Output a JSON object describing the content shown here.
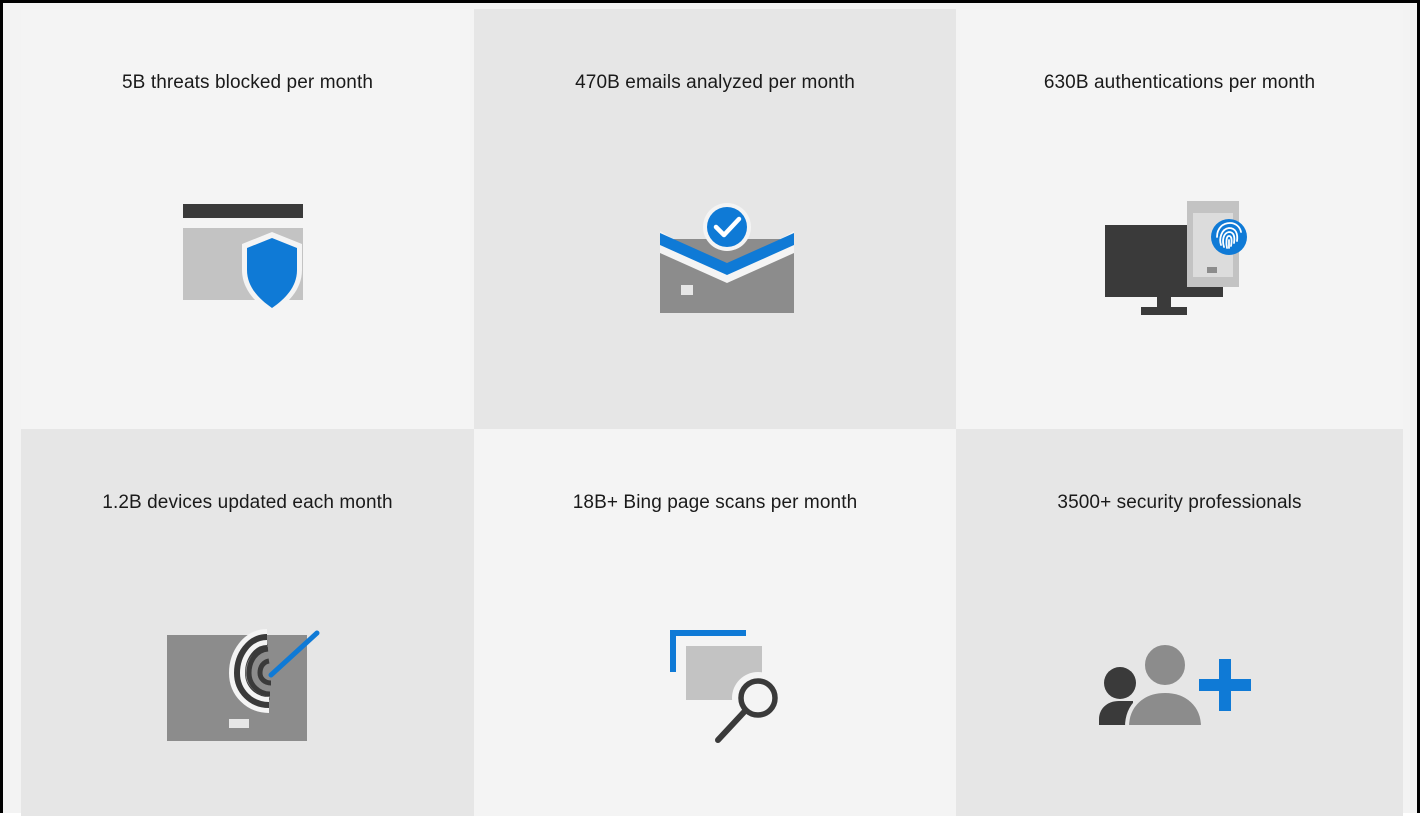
{
  "tiles": [
    {
      "title": "5B threats blocked per month",
      "icon": "browser-shield-icon"
    },
    {
      "title": "470B emails analyzed per month",
      "icon": "envelope-check-icon"
    },
    {
      "title": "630B authentications per month",
      "icon": "monitor-fingerprint-icon"
    },
    {
      "title": "1.2B devices updated each month",
      "icon": "device-signal-icon"
    },
    {
      "title": "18B+ Bing page scans per month",
      "icon": "page-search-icon"
    },
    {
      "title": "3500+ security professionals",
      "icon": "people-add-icon"
    }
  ],
  "colors": {
    "accent": "#0f7ad6",
    "dark_gray": "#3a3a3a",
    "mid_gray": "#8c8c8c",
    "light_gray": "#c3c3c3",
    "tile_light": "#f4f4f4",
    "tile_dark": "#e6e6e6"
  }
}
